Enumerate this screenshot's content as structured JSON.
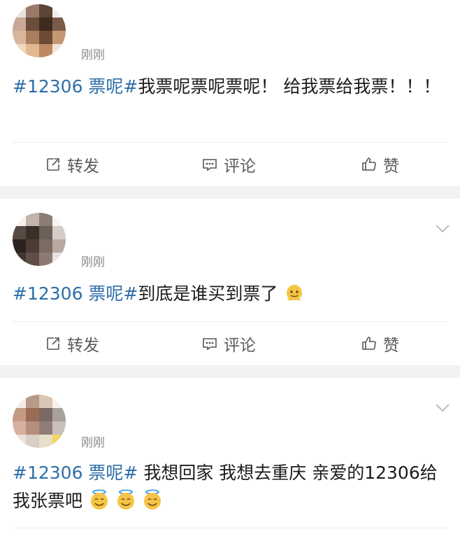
{
  "posts": [
    {
      "time": "刚刚",
      "topic": "#12306 票呢#",
      "text": "我票呢票呢票呢！ 给我票给我票！！！"
    },
    {
      "time": "刚刚",
      "topic": "#12306 票呢#",
      "text": "到底是谁买到票了",
      "emoji": "melting-face"
    },
    {
      "time": "刚刚",
      "topic": "#12306 票呢#",
      "text": " 我想回家 我想去重庆 亲爱的12306给我张票吧",
      "emoji": "smiling-face-with-halo"
    }
  ],
  "actions": {
    "repost": "转发",
    "comment": "评论",
    "like": "赞"
  },
  "colors": {
    "topic": "#2d6ea8",
    "separator": "#f2f2f2",
    "muted": "#8a8a8a"
  }
}
